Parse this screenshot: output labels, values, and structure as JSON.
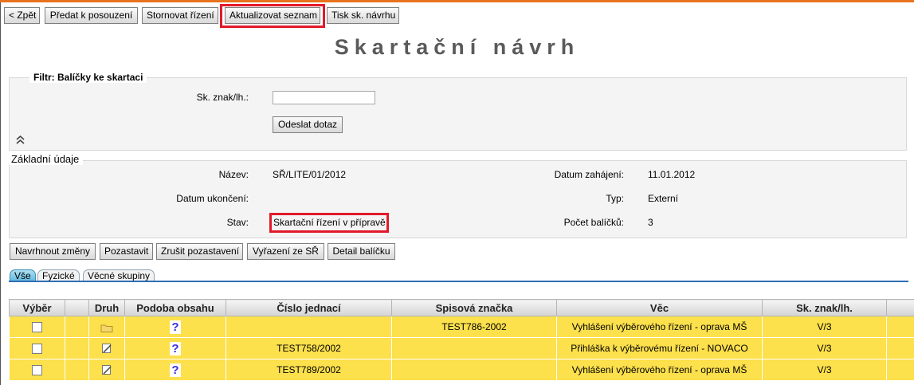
{
  "toolbar": {
    "back": "< Zpět",
    "submit_review": "Předat k posouzení",
    "cancel_procedure": "Stornovat řízení",
    "refresh_list": "Aktualizovat seznam",
    "print_proposal": "Tisk sk. návrhu"
  },
  "page_title": "Skartační návrh",
  "filter": {
    "legend": "Filtr: Balíčky ke skartaci",
    "field_label": "Sk. znak/lh.:",
    "field_value": "",
    "submit": "Odeslat dotaz"
  },
  "basic": {
    "legend": "Základní údaje",
    "name_label": "Název:",
    "name_value": "SŘ/LITE/01/2012",
    "start_label": "Datum zahájení:",
    "start_value": "11.01.2012",
    "end_label": "Datum ukončení:",
    "end_value": "",
    "type_label": "Typ:",
    "type_value": "Externí",
    "state_label": "Stav:",
    "state_value": "Skartační řízení v přípravě",
    "count_label": "Počet balíčků:",
    "count_value": "3"
  },
  "actions": {
    "propose_changes": "Navrhnout změny",
    "suspend": "Pozastavit",
    "cancel_suspend": "Zrušit pozastavení",
    "exclude": "Vyřazení ze SŘ",
    "package_detail": "Detail balíčku"
  },
  "tabs": [
    "Vše",
    "Fyzické",
    "Věcné skupiny"
  ],
  "table": {
    "columns": [
      "Výběr",
      "Druh",
      "Podoba obsahu",
      "Číslo jednací",
      "Spisová značka",
      "Věc",
      "Sk. znak/lh."
    ],
    "rows": [
      {
        "kind": "folder-icon",
        "content": "?",
        "ref_no": "",
        "file_mark": "TEST786-2002",
        "subject": "Vyhlášení výběrového řízení - oprava MŠ",
        "code": "V/3"
      },
      {
        "kind": "document-icon",
        "content": "?",
        "ref_no": "TEST758/2002",
        "file_mark": "",
        "subject": "Přihláška k výběrovému řízení - NOVACO",
        "code": "V/3"
      },
      {
        "kind": "document-icon",
        "content": "?",
        "ref_no": "TEST789/2002",
        "file_mark": "",
        "subject": "Vyhlášení výběrového řízení - oprava MŠ",
        "code": "V/3"
      }
    ]
  },
  "colors": {
    "highlight": "#e3192a",
    "row_bg": "#fce04c",
    "tab_accent": "#2f6fb5"
  }
}
